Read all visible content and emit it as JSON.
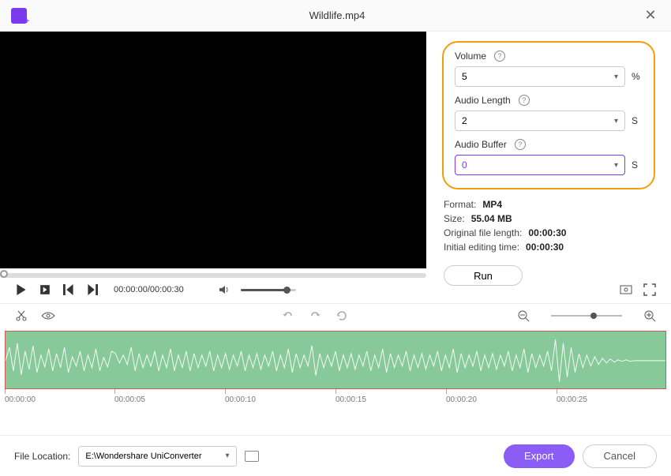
{
  "title": "Wildlife.mp4",
  "settings": {
    "volume": {
      "label": "Volume",
      "value": "5",
      "unit": "%"
    },
    "audio_length": {
      "label": "Audio Length",
      "value": "2",
      "unit": "S"
    },
    "audio_buffer": {
      "label": "Audio Buffer",
      "value": "0",
      "unit": "S"
    }
  },
  "info": {
    "format": {
      "label": "Format:",
      "value": "MP4"
    },
    "size": {
      "label": "Size:",
      "value": "55.04 MB"
    },
    "orig_len": {
      "label": "Original file length:",
      "value": "00:00:30"
    },
    "init_time": {
      "label": "Initial editing time:",
      "value": "00:00:30"
    }
  },
  "run_label": "Run",
  "player": {
    "time": "00:00:00/00:00:30"
  },
  "ruler": [
    "00:00:00",
    "00:00:05",
    "00:00:10",
    "00:00:15",
    "00:00:20",
    "00:00:25"
  ],
  "footer": {
    "loc_label": "File Location:",
    "loc_value": "E:\\Wondershare UniConverter",
    "export": "Export",
    "cancel": "Cancel"
  }
}
